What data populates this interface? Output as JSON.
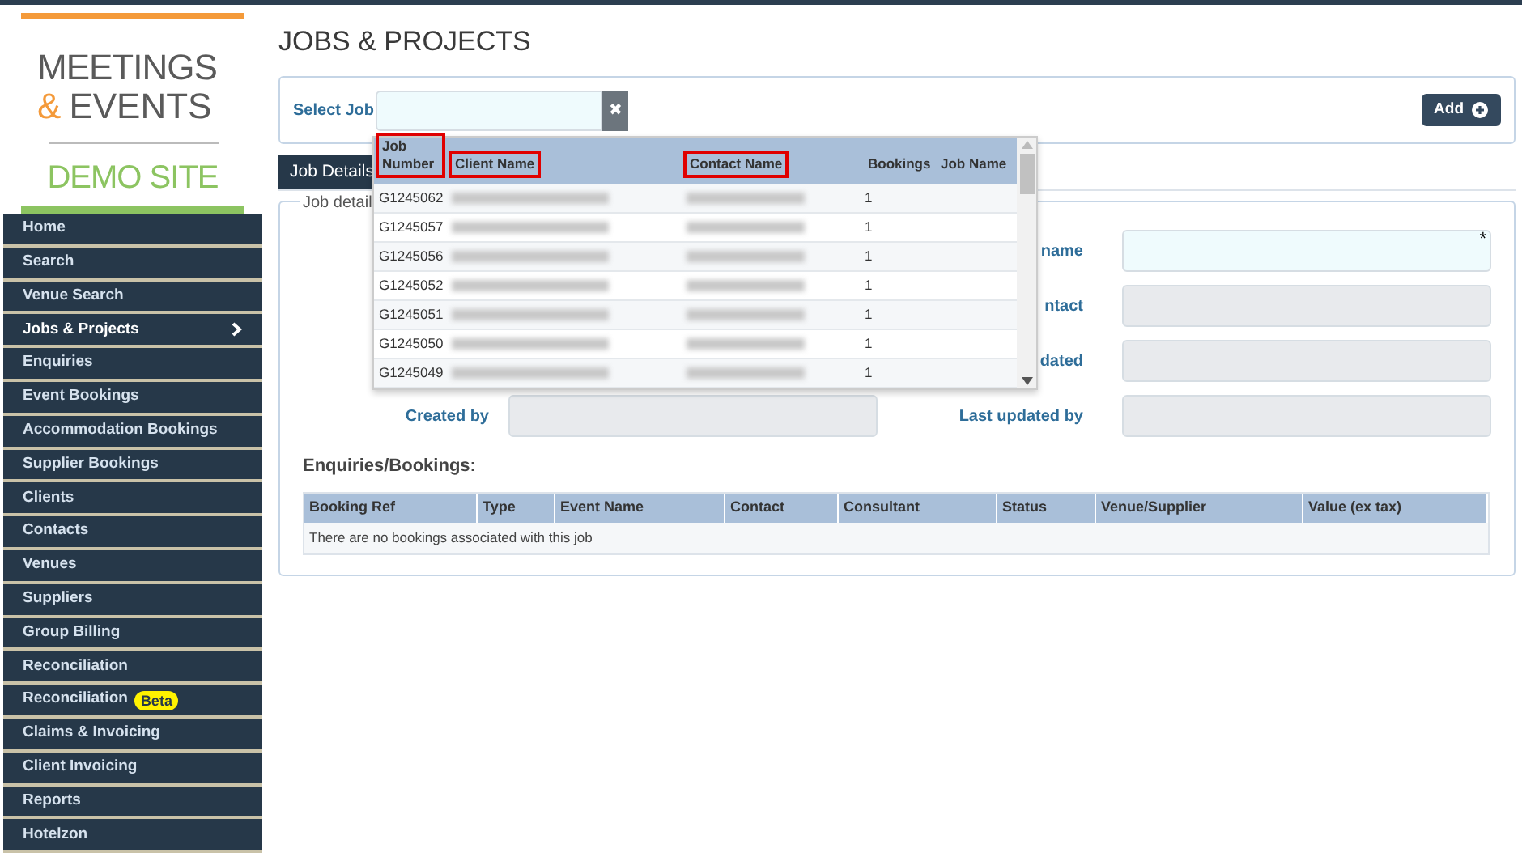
{
  "logo": {
    "line_1": "MEETINGS",
    "line_2_amp": "&",
    "line_2": "EVENTS",
    "subtitle": "DEMO SITE"
  },
  "sidebar": {
    "items": [
      {
        "label": "Home",
        "selected": false
      },
      {
        "label": "Search",
        "selected": false
      },
      {
        "label": "Venue Search",
        "selected": false
      },
      {
        "label": "Jobs & Projects",
        "selected": true
      },
      {
        "label": "Enquiries",
        "selected": false
      },
      {
        "label": "Event Bookings",
        "selected": false
      },
      {
        "label": "Accommodation Bookings",
        "selected": false
      },
      {
        "label": "Supplier Bookings",
        "selected": false
      },
      {
        "label": "Clients",
        "selected": false
      },
      {
        "label": "Contacts",
        "selected": false
      },
      {
        "label": "Venues",
        "selected": false
      },
      {
        "label": "Suppliers",
        "selected": false
      },
      {
        "label": "Group Billing",
        "selected": false
      },
      {
        "label": "Reconciliation",
        "selected": false
      },
      {
        "label": "Reconciliation",
        "badge": "Beta",
        "selected": false
      },
      {
        "label": "Claims & Invoicing",
        "selected": false
      },
      {
        "label": "Client Invoicing",
        "selected": false
      },
      {
        "label": "Reports",
        "selected": false
      },
      {
        "label": "Hotelzon",
        "selected": false
      }
    ]
  },
  "page_title": "JOBS & PROJECTS",
  "select_job": {
    "label": "Select Job",
    "clear": "✖",
    "add_button": "Add"
  },
  "job_dropdown": {
    "columns": [
      {
        "label": "Job Number",
        "kind": "text",
        "highlighted": true
      },
      {
        "label": "Client Name",
        "kind": "redacted",
        "highlighted": true
      },
      {
        "label": "Contact Name",
        "kind": "redacted",
        "highlighted": true
      },
      {
        "label": "Bookings",
        "kind": "text",
        "highlighted": false
      },
      {
        "label": "Job Name",
        "kind": "text",
        "highlighted": false
      }
    ],
    "rows": [
      {
        "job_number": "G1245062",
        "bookings": "1"
      },
      {
        "job_number": "G1245057",
        "bookings": "1"
      },
      {
        "job_number": "G1245056",
        "bookings": "1"
      },
      {
        "job_number": "G1245052",
        "bookings": "1"
      },
      {
        "job_number": "G1245051",
        "bookings": "1"
      },
      {
        "job_number": "G1245050",
        "bookings": "1"
      },
      {
        "job_number": "G1245049",
        "bookings": "1"
      }
    ]
  },
  "tabs": [
    {
      "label": "Job Details",
      "selected": true
    }
  ],
  "fieldset": {
    "legend": "Job detail",
    "rows": [
      {
        "right_label": "name",
        "right_disabled": false,
        "right_required": "*"
      },
      {
        "right_label": "ntact",
        "right_disabled": true
      },
      {
        "right_label": "dated",
        "right_disabled": true
      },
      {
        "left_label": "Created by",
        "left_disabled": true,
        "right_label": "Last updated by",
        "right_disabled": true
      }
    ]
  },
  "bookings": {
    "title": "Enquiries/Bookings:",
    "columns": [
      "Booking Ref",
      "Type",
      "Event Name",
      "Contact",
      "Consultant",
      "Status",
      "Venue/Supplier",
      "Value (ex tax)"
    ],
    "empty_message": "There are no bookings associated with this job"
  }
}
